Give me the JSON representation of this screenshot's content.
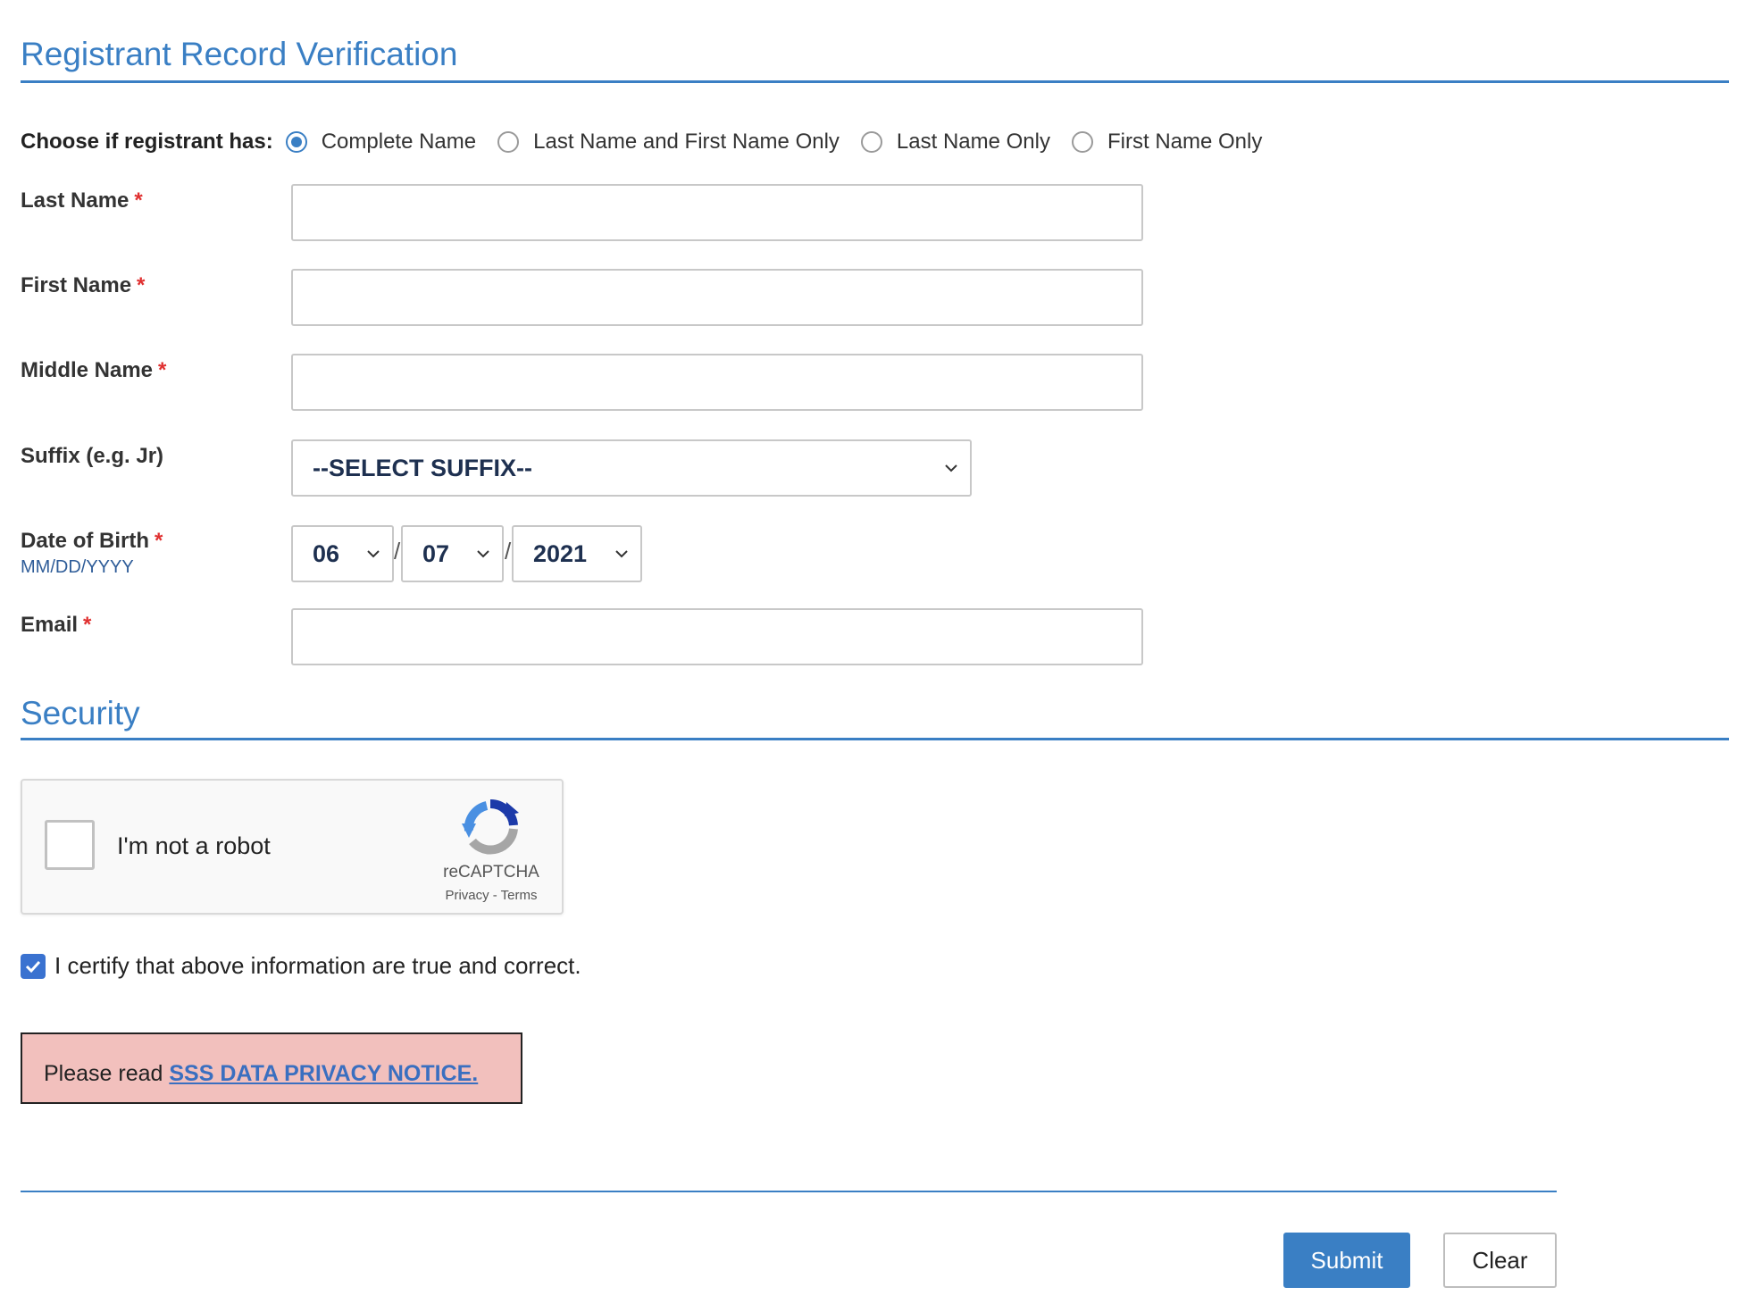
{
  "header": {
    "title": "Registrant Record Verification"
  },
  "name_options": {
    "lead": "Choose if registrant has:",
    "options": [
      {
        "label": "Complete Name",
        "selected": true
      },
      {
        "label": "Last Name and First Name Only",
        "selected": false
      },
      {
        "label": "Last Name Only",
        "selected": false
      },
      {
        "label": "First Name Only",
        "selected": false
      }
    ]
  },
  "fields": {
    "last_name": {
      "label": "Last Name",
      "required": "*",
      "value": ""
    },
    "first_name": {
      "label": "First Name",
      "required": "*",
      "value": ""
    },
    "middle_name": {
      "label": "Middle Name",
      "required": "*",
      "value": ""
    },
    "suffix": {
      "label": "Suffix (e.g. Jr)",
      "value": "--SELECT SUFFIX--"
    },
    "dob": {
      "label": "Date of Birth",
      "required": "*",
      "hint": "MM/DD/YYYY",
      "month": "06",
      "day": "07",
      "year": "2021",
      "separator": "/"
    },
    "email": {
      "label": "Email",
      "required": "*",
      "value": ""
    }
  },
  "security": {
    "title": "Security",
    "captcha": {
      "label": "I'm not a robot",
      "brand": "reCAPTCHA",
      "links": "Privacy - Terms"
    },
    "certify": {
      "label": "I certify that above information are true and correct.",
      "checked": true
    }
  },
  "notice": {
    "prefix": "Please read ",
    "link": "SSS DATA PRIVACY NOTICE."
  },
  "actions": {
    "submit": "Submit",
    "clear": "Clear"
  },
  "colors": {
    "accent": "#3a7fc4",
    "required": "#e03030",
    "notice_bg": "#f2c0bd"
  }
}
